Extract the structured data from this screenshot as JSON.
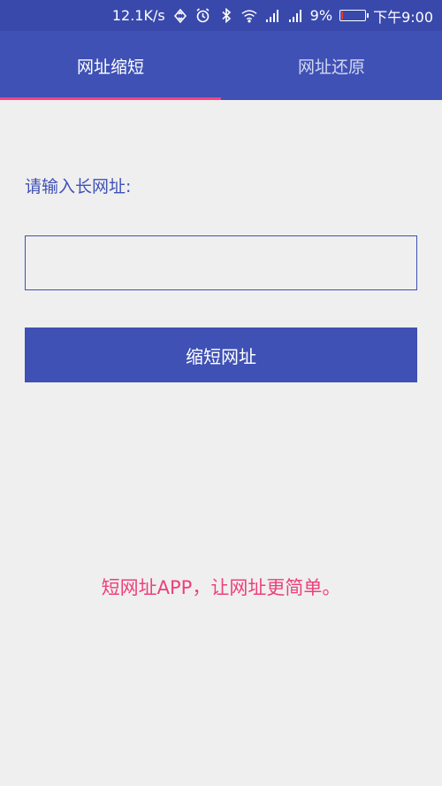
{
  "status_bar": {
    "network_speed": "12.1K/s",
    "battery_percent": "9%",
    "battery_level": 0.09,
    "time": "下午9:00",
    "icons": [
      "data-sync-icon",
      "alarm-icon",
      "bluetooth-icon",
      "wifi-icon",
      "signal-icon",
      "signal-icon",
      "battery-icon"
    ]
  },
  "tabs": [
    {
      "label": "网址缩短",
      "active": true
    },
    {
      "label": "网址还原",
      "active": false
    }
  ],
  "form": {
    "prompt_label": "请输入长网址:",
    "input_value": "",
    "button_label": "缩短网址"
  },
  "slogan": "短网址APP，让网址更简单。",
  "colors": {
    "primary": "#3f51b5",
    "status_bar": "#3949ab",
    "accent": "#ff4081",
    "slogan": "#ec407a",
    "background": "#efefef"
  }
}
